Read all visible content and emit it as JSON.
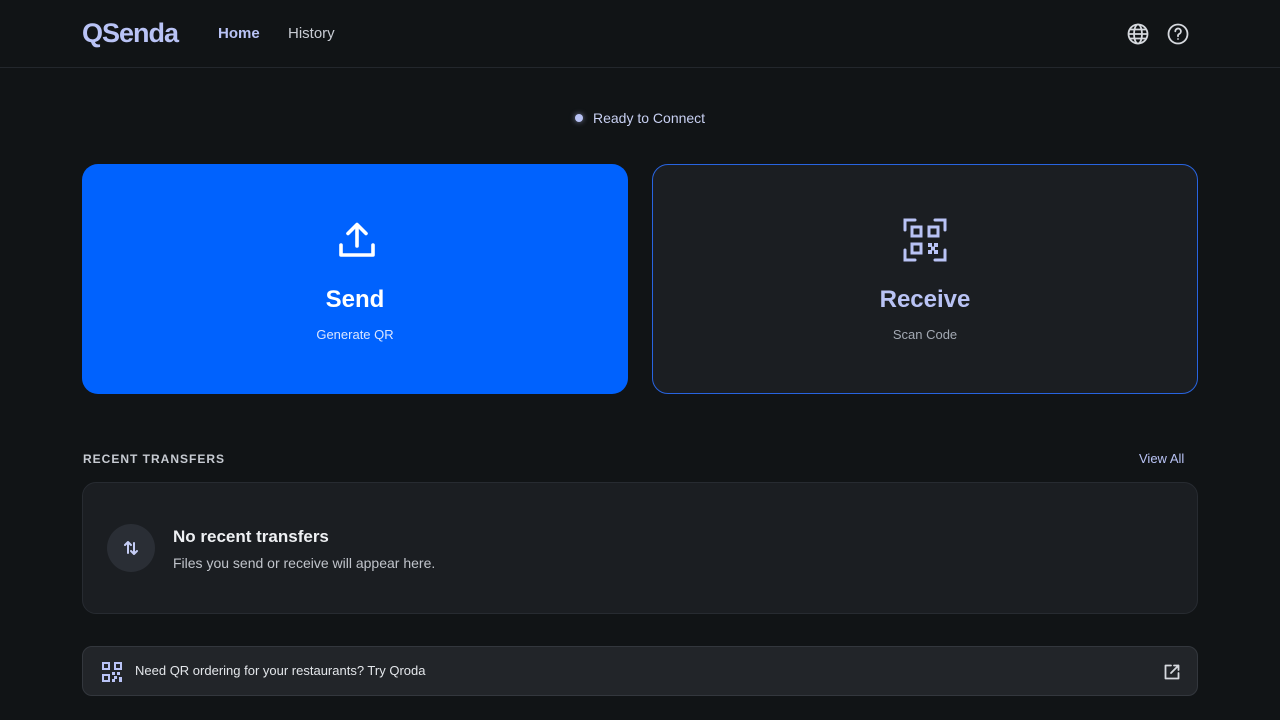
{
  "header": {
    "logo": "QSenda",
    "nav": [
      {
        "label": "Home",
        "active": true
      },
      {
        "label": "History",
        "active": false
      }
    ],
    "icons": [
      "globe-icon",
      "help-icon"
    ]
  },
  "status": {
    "text": "Ready to Connect"
  },
  "actions": {
    "send": {
      "title": "Send",
      "subtitle": "Generate QR",
      "icon": "upload-icon"
    },
    "receive": {
      "title": "Receive",
      "subtitle": "Scan Code",
      "icon": "qr-scan-icon"
    }
  },
  "recent": {
    "title": "RECENT TRANSFERS",
    "view_all": "View All",
    "empty_title": "No recent transfers",
    "empty_desc": "Files you send or receive will appear here.",
    "empty_icon": "transfer-arrows-icon"
  },
  "promo": {
    "text": "Need QR ordering for your restaurants? Try Qroda",
    "icon": "qr-code-icon",
    "link_icon": "external-link-icon"
  },
  "colors": {
    "background": "#111416",
    "accent": "#b9c3f5",
    "primary": "#0062fe",
    "card": "#1b1e22"
  }
}
